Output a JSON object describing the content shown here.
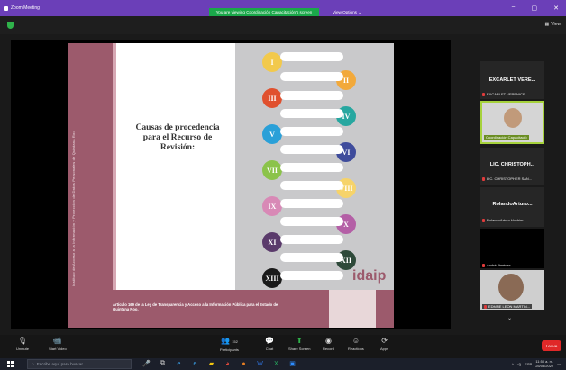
{
  "window": {
    "title": "Zoom Meeting",
    "controls": [
      "−",
      "▢",
      "✕"
    ]
  },
  "banner": {
    "viewing": "You are viewing Coordinación Capacitación's screen",
    "view_options": "View Options ⌄"
  },
  "top_right": {
    "view_label": "View"
  },
  "slide": {
    "heading": "Causas de procedencia para el Recurso de Revisión:",
    "side_text": "Instituto de Acceso a la Información y Protección de Datos Personales de Quintana Roo",
    "footer_text": "Artículo 169 de la Ley de Transparencia y Acceso a la Información Pública para el Estado de Quintana Roo.",
    "logo_text": "idaip",
    "numerals": [
      "I",
      "II",
      "III",
      "IV",
      "V",
      "VI",
      "VII",
      "VIII",
      "IX",
      "X",
      "XI",
      "XII",
      "XIII"
    ]
  },
  "participants": [
    {
      "name": "EXCARLET VERE...",
      "sub": "EXCARLET VERENICE..."
    },
    {
      "name": "Coordinación Capacitació",
      "sub": ""
    },
    {
      "name": "LIC. CHRISTOPH...",
      "sub": "LIC. CHRISTOPHER SAN..."
    },
    {
      "name": "RolandoArturo...",
      "sub": "RolandoArturo Huchim"
    },
    {
      "name": "",
      "sub": "André Jiménez"
    },
    {
      "name": "",
      "sub": "EDMNE LEON MARTIN..."
    }
  ],
  "toolbar": {
    "unmute": "Unmute",
    "start_video": "Start Video",
    "participants": "Participants",
    "participants_count": "152",
    "chat": "Chat",
    "share_screen": "Share Screen",
    "record": "Record",
    "reactions": "Reactions",
    "apps": "Apps",
    "leave": "Leave"
  },
  "taskbar": {
    "search_placeholder": "Escribe aquí para buscar",
    "time": "11:50 a. m.",
    "date": "25/05/2022",
    "language": "ESP"
  }
}
